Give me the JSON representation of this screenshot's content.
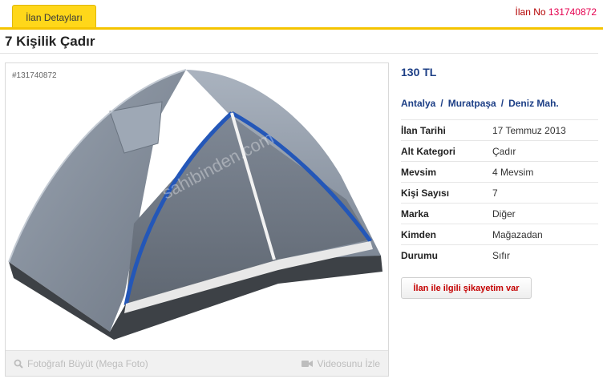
{
  "tabs": {
    "active_label": "İlan Detayları"
  },
  "listing": {
    "no_label": "İlan No",
    "no_value": "131740872",
    "title": "7 Kişilik Çadır",
    "photo_id": "#131740872",
    "price": "130 TL",
    "location": [
      "Antalya",
      "Muratpaşa",
      "Deniz Mah."
    ],
    "location_separator": "/",
    "details": [
      {
        "key": "İlan Tarihi",
        "value": "17 Temmuz 2013"
      },
      {
        "key": "Alt Kategori",
        "value": "Çadır"
      },
      {
        "key": "Mevsim",
        "value": "4 Mevsim"
      },
      {
        "key": "Kişi Sayısı",
        "value": "7"
      },
      {
        "key": "Marka",
        "value": "Diğer"
      },
      {
        "key": "Kimden",
        "value": "Mağazadan"
      },
      {
        "key": "Durumu",
        "value": "Sıfır"
      }
    ],
    "complaint_button": "İlan ile ilgili şikayetim var"
  },
  "photo_footer": {
    "enlarge_label": "Fotoğrafı Büyüt (Mega Foto)",
    "video_label": "Videosunu İzle",
    "enlarge_icon": "search-icon",
    "video_icon": "video-camera-icon"
  },
  "colors": {
    "tab_yellow": "#ffd71a",
    "accent_line": "#f5c400",
    "link_blue": "#1d3f86",
    "ilan_no_red": "#e5004f",
    "complaint_red": "#c40000"
  }
}
